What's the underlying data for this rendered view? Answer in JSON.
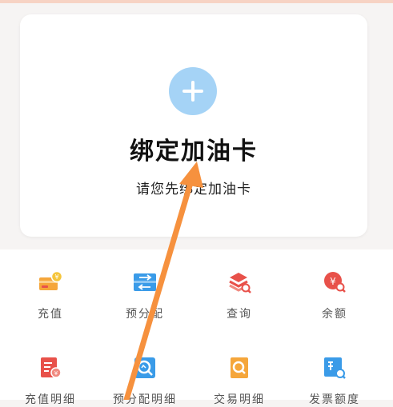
{
  "card": {
    "title": "绑定加油卡",
    "subtitle": "请您先绑定加油卡"
  },
  "menu": {
    "items": [
      {
        "label": "充值",
        "icon": "card-yen-icon"
      },
      {
        "label": "预分配",
        "icon": "transfer-icon"
      },
      {
        "label": "查询",
        "icon": "stack-search-icon"
      },
      {
        "label": "余额",
        "icon": "yen-search-icon"
      },
      {
        "label": "充值明细",
        "icon": "receipt-yen-icon"
      },
      {
        "label": "预分配明细",
        "icon": "chart-search-icon"
      },
      {
        "label": "交易明细",
        "icon": "document-search-icon"
      },
      {
        "label": "发票额度",
        "icon": "invoice-search-icon"
      }
    ]
  },
  "colors": {
    "accent_blue": "#a5d3f6",
    "arrow_orange": "#f6913e",
    "orange_icon": "#f5a63b",
    "blue_icon": "#3a9be8",
    "red_icon": "#e8514a"
  }
}
